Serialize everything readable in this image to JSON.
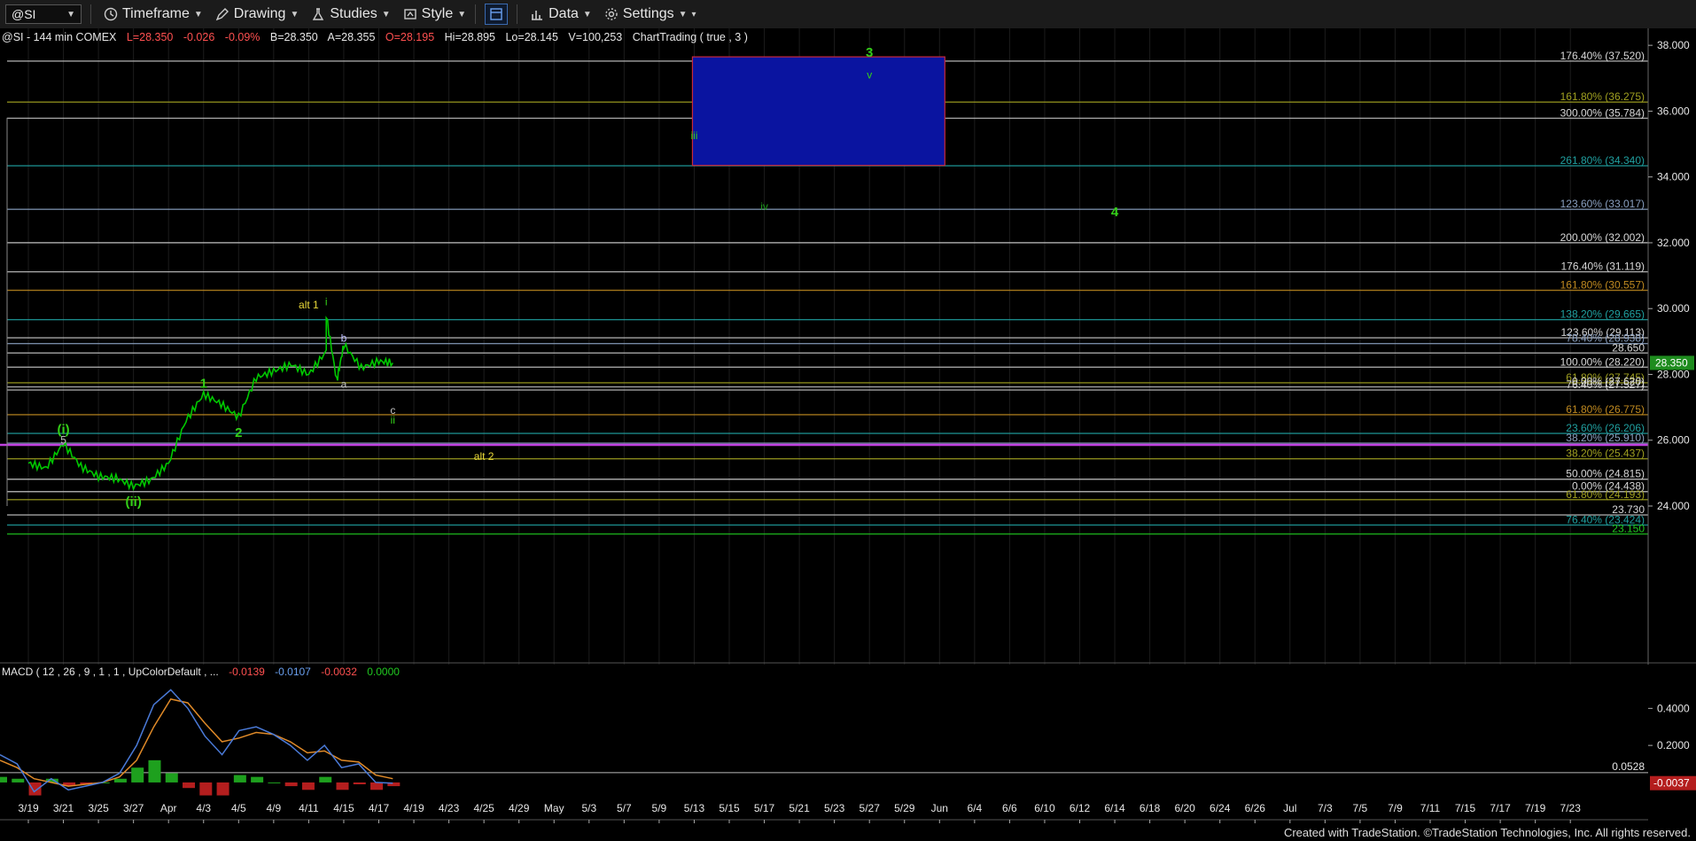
{
  "toolbar": {
    "symbol": "@SI",
    "timeframe": "Timeframe",
    "drawing": "Drawing",
    "studies": "Studies",
    "style": "Style",
    "data": "Data",
    "settings": "Settings"
  },
  "header": {
    "symbol_line": "@SI - 144 min  COMEX",
    "last": "L=28.350",
    "change": "-0.026",
    "pct": "-0.09%",
    "bid": "B=28.350",
    "ask": "A=28.355",
    "open": "O=28.195",
    "high": "Hi=28.895",
    "low": "Lo=28.145",
    "volume": "V=100,253",
    "study": "ChartTrading ( true , 3 )"
  },
  "macd_header": {
    "label": "MACD ( 12 , 26 , 9 , 1 , 1 , UpColorDefault , ...",
    "v1": "-0.0139",
    "v2": "-0.0107",
    "v3": "-0.0032",
    "v4": "0.0000"
  },
  "footer": "Created with TradeStation. ©TradeStation Technologies, Inc. All rights reserved.",
  "colors": {
    "background": "#000000",
    "price_bars": "#00c800",
    "wave_green": "#34d018",
    "wave_dark_green": "#1e9a1e",
    "wave_yellow": "#e8d838",
    "box_fill": "#0a14a0",
    "box_border": "#c8283c",
    "magenta": "#c040e0",
    "last_price_tag": "#1e8c1e",
    "macd_line": "#4a7ad8",
    "signal_line": "#e08a28",
    "hist_up": "#1ea01e",
    "hist_down": "#b41e1e"
  },
  "chart_data": {
    "type": "line",
    "title": "@SI - 144 min COMEX",
    "price_axis": {
      "ticks": [
        "38.000",
        "36.000",
        "34.000",
        "32.000",
        "30.000",
        "28.000",
        "26.000",
        "24.000"
      ],
      "last_price": "28.350"
    },
    "x_ticks": [
      "3/19",
      "3/21",
      "3/25",
      "3/27",
      "Apr",
      "4/3",
      "4/5",
      "4/9",
      "4/11",
      "4/15",
      "4/17",
      "4/19",
      "4/23",
      "4/25",
      "4/29",
      "May",
      "5/3",
      "5/7",
      "5/9",
      "5/13",
      "5/15",
      "5/17",
      "5/21",
      "5/23",
      "5/27",
      "5/29",
      "Jun",
      "6/4",
      "6/6",
      "6/10",
      "6/12",
      "6/14",
      "6/18",
      "6/20",
      "6/24",
      "6/26",
      "Jul",
      "7/3",
      "7/5",
      "7/9",
      "7/11",
      "7/15",
      "7/17",
      "7/19",
      "7/23"
    ],
    "price_path": [
      {
        "x": "3/19",
        "y": 25.3
      },
      {
        "x": "3/20",
        "y": 25.15
      },
      {
        "x": "3/21",
        "y": 25.9
      },
      {
        "x": "3/22",
        "y": 25.2
      },
      {
        "x": "3/25",
        "y": 24.9
      },
      {
        "x": "3/26",
        "y": 24.85
      },
      {
        "x": "3/27",
        "y": 24.6
      },
      {
        "x": "3/28",
        "y": 24.8
      },
      {
        "x": "Apr",
        "y": 25.3
      },
      {
        "x": "4/2",
        "y": 26.6
      },
      {
        "x": "4/3",
        "y": 27.4
      },
      {
        "x": "4/4",
        "y": 27.1
      },
      {
        "x": "4/5",
        "y": 26.7
      },
      {
        "x": "4/8",
        "y": 27.9
      },
      {
        "x": "4/9",
        "y": 28.1
      },
      {
        "x": "4/10",
        "y": 28.3
      },
      {
        "x": "4/11",
        "y": 28.0
      },
      {
        "x": "4/12",
        "y": 28.7
      },
      {
        "x": "4/12",
        "y": 29.8
      },
      {
        "x": "4/13",
        "y": 27.8
      },
      {
        "x": "4/15",
        "y": 28.9
      },
      {
        "x": "4/16",
        "y": 28.2
      },
      {
        "x": "4/17",
        "y": 28.4
      },
      {
        "x": "4/18",
        "y": 28.35
      }
    ],
    "levels": [
      {
        "label": "176.40% (37.520)",
        "value": 37.52,
        "color": "#c0c0c0"
      },
      {
        "label": "161.80% (36.275)",
        "value": 36.275,
        "color": "#a0a020"
      },
      {
        "label": "300.00% (35.784)",
        "value": 35.784,
        "color": "#c0c0c0"
      },
      {
        "label": "261.80% (34.340)",
        "value": 34.34,
        "color": "#20a0a0"
      },
      {
        "label": "123.60% (33.017)",
        "value": 33.017,
        "color": "#8aa0c0"
      },
      {
        "label": "200.00% (32.002)",
        "value": 32.002,
        "color": "#c0c0c0"
      },
      {
        "label": "176.40% (31.119)",
        "value": 31.119,
        "color": "#c0c0c0"
      },
      {
        "label": "161.80% (30.557)",
        "value": 30.557,
        "color": "#c08a20"
      },
      {
        "label": "138.20% (29.665)",
        "value": 29.665,
        "color": "#20a0a0"
      },
      {
        "label": "123.60% (29.113)",
        "value": 29.113,
        "color": "#c0c0c0"
      },
      {
        "label": "78.40% (28.938)",
        "value": 28.938,
        "color": "#8aa0c0"
      },
      {
        "label": "28.650",
        "value": 28.65,
        "color": "#c0c0c0"
      },
      {
        "label": "100.00% (28.220)",
        "value": 28.22,
        "color": "#c0c0c0"
      },
      {
        "label": "61.80% (27.745)",
        "value": 27.745,
        "color": "#a0a020"
      },
      {
        "label": "0.00% (27.620)",
        "value": 27.62,
        "color": "#c0c0c0"
      },
      {
        "label": "76.40% (27.527)",
        "value": 27.527,
        "color": "#c0c0c0"
      },
      {
        "label": "61.80% (26.775)",
        "value": 26.775,
        "color": "#c08a20"
      },
      {
        "label": "23.60% (26.206)",
        "value": 26.206,
        "color": "#20a0a0"
      },
      {
        "label": "38.20% (25.910)",
        "value": 25.91,
        "color": "#8aa0c0"
      },
      {
        "label": "38.20% (25.437)",
        "value": 25.437,
        "color": "#a0a020"
      },
      {
        "label": "50.00% (24.815)",
        "value": 24.815,
        "color": "#c0c0c0"
      },
      {
        "label": "0.00% (24.438)",
        "value": 24.438,
        "color": "#c0c0c0"
      },
      {
        "label": "61.80% (24.193)",
        "value": 24.193,
        "color": "#a0a020"
      },
      {
        "label": "23.730",
        "value": 23.73,
        "color": "#c0c0c0"
      },
      {
        "label": "76.40% (23.424)",
        "value": 23.424,
        "color": "#20a0a0"
      },
      {
        "label": "23.150",
        "value": 23.15,
        "color": "#20c820"
      }
    ],
    "target_box": {
      "x_from": "5/13",
      "x_to": "Jun",
      "y_from": 34.35,
      "y_to": 37.65
    },
    "wave_labels": [
      {
        "text": "3",
        "x": "5/27",
        "y": 37.65,
        "color": "#34d018"
      },
      {
        "text": "v",
        "x": "5/27",
        "y": 37.0,
        "color": "#34d018"
      },
      {
        "text": "iii",
        "x": "5/13",
        "y": 35.15,
        "color": "#34d018"
      },
      {
        "text": "iv",
        "x": "5/17",
        "y": 33.0,
        "color": "#1e9a1e"
      },
      {
        "text": "4",
        "x": "6/14",
        "y": 32.8,
        "color": "#34d018"
      },
      {
        "text": "alt 1",
        "x": "4/11",
        "y": 30.0,
        "color": "#e8d838"
      },
      {
        "text": "i",
        "x": "4/12",
        "y": 30.1,
        "color": "#34d018"
      },
      {
        "text": "b",
        "x": "4/15",
        "y": 29.0,
        "color": "#c0c0ff"
      },
      {
        "text": "1",
        "x": "4/3",
        "y": 27.6,
        "color": "#34d018"
      },
      {
        "text": "a",
        "x": "4/15",
        "y": 27.6,
        "color": "#c0c0c0"
      },
      {
        "text": "c",
        "x": "4/18",
        "y": 26.8,
        "color": "#c0c0c0"
      },
      {
        "text": "ii",
        "x": "4/18",
        "y": 26.5,
        "color": "#34d018"
      },
      {
        "text": "(i)",
        "x": "3/21",
        "y": 26.2,
        "color": "#34d018"
      },
      {
        "text": "5",
        "x": "3/21",
        "y": 25.9,
        "color": "#c0c0c0"
      },
      {
        "text": "2",
        "x": "4/5",
        "y": 26.1,
        "color": "#34d018"
      },
      {
        "text": "alt 2",
        "x": "4/25",
        "y": 25.4,
        "color": "#e8d838"
      },
      {
        "text": "(ii)",
        "x": "3/27",
        "y": 24.0,
        "color": "#34d018"
      }
    ],
    "macd": {
      "ticks": [
        "0.4000",
        "0.2000"
      ],
      "level": "0.0528",
      "last": "-0.0037",
      "macd_path": [
        0.15,
        0.1,
        -0.05,
        0.02,
        -0.04,
        -0.02,
        0.0,
        0.05,
        0.2,
        0.42,
        0.5,
        0.4,
        0.25,
        0.15,
        0.28,
        0.3,
        0.26,
        0.2,
        0.12,
        0.2,
        0.08,
        0.1,
        0.0,
        -0.0037
      ],
      "signal_path": [
        0.12,
        0.08,
        0.02,
        0.0,
        -0.02,
        -0.01,
        0.0,
        0.03,
        0.12,
        0.3,
        0.45,
        0.43,
        0.32,
        0.22,
        0.24,
        0.27,
        0.26,
        0.22,
        0.16,
        0.17,
        0.12,
        0.11,
        0.04,
        0.02
      ],
      "histogram": [
        0.03,
        0.02,
        -0.07,
        0.02,
        -0.02,
        -0.01,
        0.0,
        0.02,
        0.08,
        0.12,
        0.05,
        -0.03,
        -0.07,
        -0.07,
        0.04,
        0.03,
        0.0,
        -0.02,
        -0.04,
        0.03,
        -0.04,
        -0.01,
        -0.04,
        -0.02
      ]
    }
  }
}
